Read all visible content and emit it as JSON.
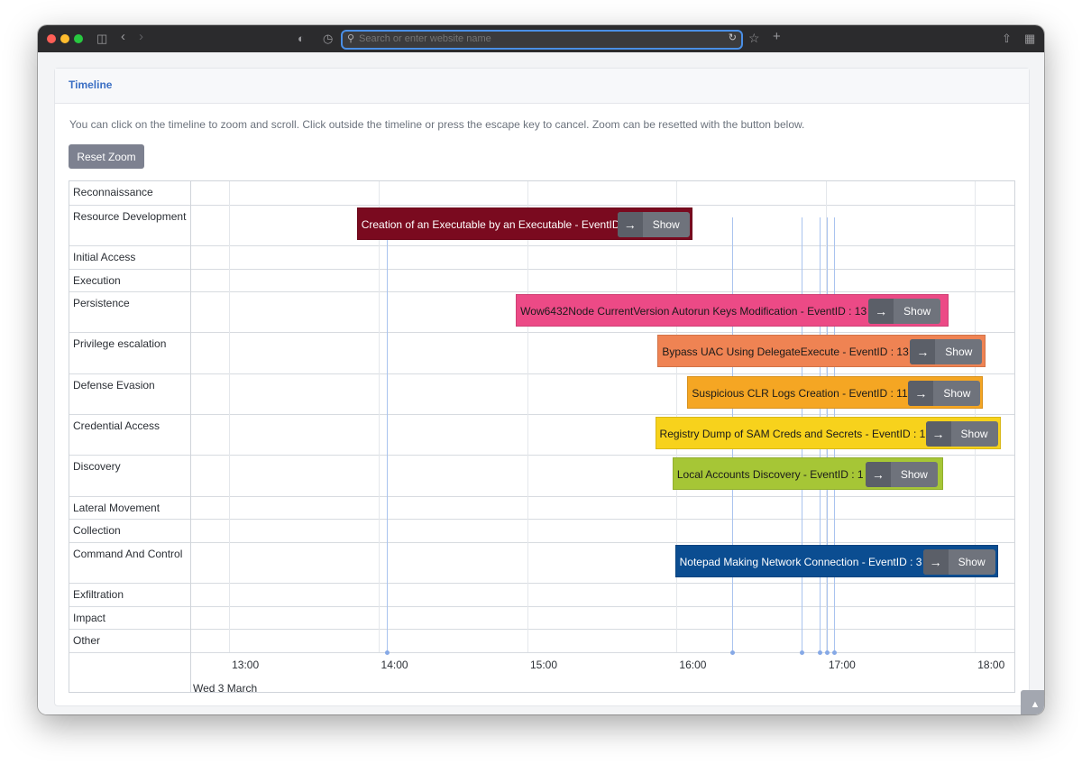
{
  "browser": {
    "address_placeholder": "Search or enter website name"
  },
  "card": {
    "title": "Timeline",
    "help_text": "You can click on the timeline to zoom and scroll. Click outside the timeline or press the escape key to cancel. Zoom can be resetted with the button below.",
    "reset_label": "Reset Zoom"
  },
  "timeline": {
    "rows": [
      "Reconnaissance",
      "Resource Development",
      "Initial Access",
      "Execution",
      "Persistence",
      "Privilege escalation",
      "Defense Evasion",
      "Credential Access",
      "Discovery",
      "Lateral Movement",
      "Collection",
      "Command And Control",
      "Exfiltration",
      "Impact",
      "Other"
    ],
    "ticks": [
      "13:00",
      "14:00",
      "15:00",
      "16:00",
      "17:00",
      "18:00"
    ],
    "date_label": "Wed 3 March",
    "show_label": "Show",
    "events": [
      {
        "row": "Resource Development",
        "label": "Creation of an Executable by an Executable - EventID : 11",
        "start": "13:47",
        "end": "16:02",
        "color": "#7a0a1f",
        "text": "#ffffff"
      },
      {
        "row": "Persistence",
        "label": "Wow6432Node CurrentVersion Autorun Keys Modification - EventID : 13",
        "start": "14:51",
        "end": "17:45",
        "color": "#ec4a86",
        "text": "#1a1a1a"
      },
      {
        "row": "Privilege escalation",
        "label": "Bypass UAC Using DelegateExecute - EventID : 13",
        "start": "15:48",
        "end": "18:00",
        "color": "#ef8353",
        "text": "#1a1a1a"
      },
      {
        "row": "Defense Evasion",
        "label": "Suspicious CLR Logs Creation - EventID : 11",
        "start": "16:00",
        "end": "17:59",
        "color": "#f5a623",
        "text": "#1a1a1a"
      },
      {
        "row": "Credential Access",
        "label": "Registry Dump of SAM Creds and Secrets - EventID : 1",
        "start": "15:47",
        "end": "18:06",
        "color": "#f7d21c",
        "text": "#1a1a1a"
      },
      {
        "row": "Discovery",
        "label": "Local Accounts Discovery - EventID : 1",
        "start": "15:54",
        "end": "17:43",
        "color": "#a6c636",
        "text": "#1a1a1a"
      },
      {
        "row": "Command And Control",
        "label": "Notepad Making Network Connection - EventID : 3",
        "start": "15:55",
        "end": "18:05",
        "color": "#0b4d91",
        "text": "#ffffff"
      }
    ],
    "markers": [
      "13:59",
      "16:18",
      "16:46",
      "16:53",
      "16:56",
      "16:59"
    ]
  }
}
